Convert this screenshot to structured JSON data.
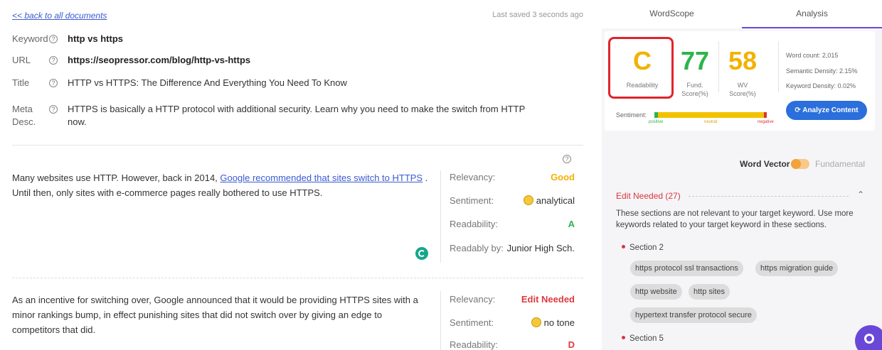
{
  "editor": {
    "back_link": "<< back to all documents",
    "saved": "Last saved 3 seconds ago",
    "keyword_label": "Keyword",
    "keyword_value": "http vs https",
    "url_label": "URL",
    "url_value": "https://seopressor.com/blog/http-vs-https",
    "title_label": "Title",
    "title_value": "HTTP vs HTTPS: The Difference And Everything You Need To Know",
    "meta_label_1": "Meta",
    "meta_label_2": "Desc.",
    "meta_value_1": "HTTPS is basically a HTTP protocol with additional security. Learn why you need to make the switch from HTTP",
    "meta_value_2": "now.",
    "help_glyph": "?"
  },
  "sections": [
    {
      "text_1": "Many websites use HTTP. However, back in 2014,",
      "link": "Google recommended that sites switch to HTTPS",
      "text_2": ". Until then, only sites with e-commerce pages really bothered to use HTTPS.",
      "relevancy_label": "Relevancy:",
      "relevancy_value": "Good",
      "sentiment_label": "Sentiment:",
      "sentiment_value": "analytical",
      "readability_label": "Readability:",
      "readability_value": "A",
      "readably_label": "Readably by:",
      "readably_value": "Junior High Sch."
    },
    {
      "line_1": "As an incentive for switching over, Google announced that it would be providing HTTPS sites with a",
      "line_2": "minor rankings bump, in effect punishing sites that did not switch over by giving an edge to",
      "line_3": "competitors that did.",
      "relevancy_label": "Relevancy:",
      "relevancy_value": "Edit Needed",
      "sentiment_label": "Sentiment:",
      "sentiment_value": "no tone",
      "readability_label": "Readability:",
      "readability_value": "D"
    }
  ],
  "panel": {
    "tabs": [
      "WordScope",
      "Analysis"
    ],
    "readability_grade": "C",
    "readability_label": "Readability",
    "fund_score": "77",
    "fund_label_1": "Fund.",
    "fund_label_2": "Score(%)",
    "wv_score": "58",
    "wv_label_1": "WV",
    "wv_label_2": "Score(%)",
    "word_count": "Word count: 2,015",
    "semantic_density": "Semantic Density: 2.15%",
    "keyword_density": "Keyword Density: 0.02%",
    "analyze_button": "Analyze Content",
    "sentiment_label": "Sentiment:",
    "sentiment_positive": "positive",
    "sentiment_neutral": "neutral",
    "sentiment_negative": "negative",
    "word_vector_label": "Word Vector",
    "fundamental_label": "Fundamental",
    "edit_needed_title": "Edit Needed (27)",
    "edit_desc": "These sections are not relevant to your target keyword. Use more keywords related to your target keyword in these sections.",
    "section_2": "Section 2",
    "chips": [
      "https protocol ssl transactions",
      "https migration guide",
      "http website",
      "http sites",
      "hypertext transfer protocol secure"
    ],
    "section_5": "Section 5"
  },
  "colors": {
    "grade_c": "#f2b200",
    "fund_green": "#2bb54a",
    "wv_orange": "#f2b200",
    "accent_purple": "#6b4bd6",
    "button_blue": "#2a6fdb",
    "edit_red": "#d9363e"
  }
}
